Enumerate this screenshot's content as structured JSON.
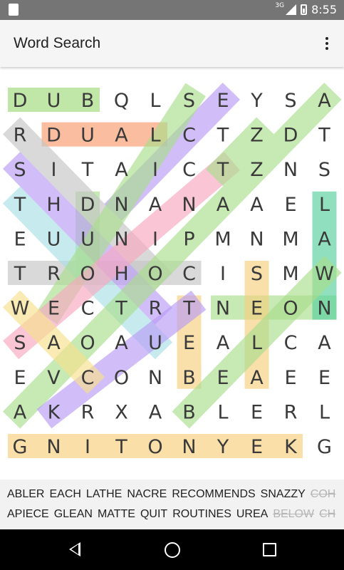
{
  "status_bar": {
    "network": "3G",
    "time": "8:55"
  },
  "app": {
    "title": "Word Search"
  },
  "grid": {
    "rows": [
      "DUBQLSEYSA",
      "RDUALCTZDT",
      "SITAICTZNS",
      "THDNANAAEL",
      "EUUNIPMNMA",
      "TROHOCISMW",
      "WECTRTNEON",
      "SAOAUEALCA",
      "EVCONBEAEE",
      "AKRXABLERL",
      "GNITONYEKG"
    ]
  },
  "highlights": [
    {
      "from": [
        0,
        0
      ],
      "to": [
        0,
        2
      ],
      "color": "#9ed87a"
    },
    {
      "from": [
        1,
        1
      ],
      "to": [
        1,
        4
      ],
      "color": "#f79a6b"
    },
    {
      "from": [
        10,
        0
      ],
      "to": [
        10,
        8
      ],
      "color": "#f7cf7a"
    },
    {
      "from": [
        5,
        0
      ],
      "to": [
        5,
        5
      ],
      "color": "#c4c4c4"
    },
    {
      "from": [
        6,
        6
      ],
      "to": [
        6,
        9
      ],
      "color": "#a9dd8c"
    },
    {
      "from": [
        3,
        9
      ],
      "to": [
        6,
        9
      ],
      "color": "#55cf9c"
    },
    {
      "from": [
        6,
        5
      ],
      "to": [
        8,
        5
      ],
      "color": "#f6cf7e"
    },
    {
      "from": [
        5,
        7
      ],
      "to": [
        8,
        7
      ],
      "color": "#f6cf7e"
    },
    {
      "from": [
        3,
        2
      ],
      "to": [
        5,
        2
      ],
      "color": "#a9dd8c"
    },
    {
      "from": [
        1,
        0
      ],
      "to": [
        5,
        4
      ],
      "color": "#c4c4c4"
    },
    {
      "from": [
        2,
        0
      ],
      "to": [
        6,
        4
      ],
      "color": "#b99bf5"
    },
    {
      "from": [
        3,
        0
      ],
      "to": [
        7,
        4
      ],
      "color": "#a9dfe6"
    },
    {
      "from": [
        0,
        6
      ],
      "to": [
        3,
        3
      ],
      "color": "#b99bf5"
    },
    {
      "from": [
        0,
        5
      ],
      "to": [
        6,
        1
      ],
      "color": "#a9dd8c"
    },
    {
      "from": [
        2,
        6
      ],
      "to": [
        7,
        0
      ],
      "color": "#f7a8c0"
    },
    {
      "from": [
        0,
        9
      ],
      "to": [
        9,
        0
      ],
      "color": "#a9dd8c"
    },
    {
      "from": [
        6,
        5
      ],
      "to": [
        9,
        1
      ],
      "color": "#b99bf5"
    },
    {
      "from": [
        6,
        0
      ],
      "to": [
        8,
        2
      ],
      "color": "#f7e08c"
    },
    {
      "from": [
        1,
        7
      ],
      "to": [
        2,
        6
      ],
      "color": "#a9dd8c"
    },
    {
      "from": [
        5,
        9
      ],
      "to": [
        9,
        5
      ],
      "color": "#a9dd8c"
    }
  ],
  "word_list": {
    "row1": [
      {
        "text": "ABLER",
        "found": false
      },
      {
        "text": "EACH",
        "found": false
      },
      {
        "text": "LATHE",
        "found": false
      },
      {
        "text": "NACRE",
        "found": false
      },
      {
        "text": "RECOMMENDS",
        "found": false
      },
      {
        "text": "SNAZZY",
        "found": false
      },
      {
        "text": "COH",
        "found": true
      }
    ],
    "row2": [
      {
        "text": "APIECE",
        "found": false
      },
      {
        "text": "GLEAN",
        "found": false
      },
      {
        "text": "MATTE",
        "found": false
      },
      {
        "text": "QUIT",
        "found": false
      },
      {
        "text": "ROUTINES",
        "found": false
      },
      {
        "text": "UREA",
        "found": false
      },
      {
        "text": "BELOW",
        "found": true
      },
      {
        "text": "CH",
        "found": true
      }
    ]
  },
  "nav": {
    "back_icon": "back-triangle-icon",
    "home_icon": "home-circle-icon",
    "recents_icon": "recents-square-icon"
  }
}
